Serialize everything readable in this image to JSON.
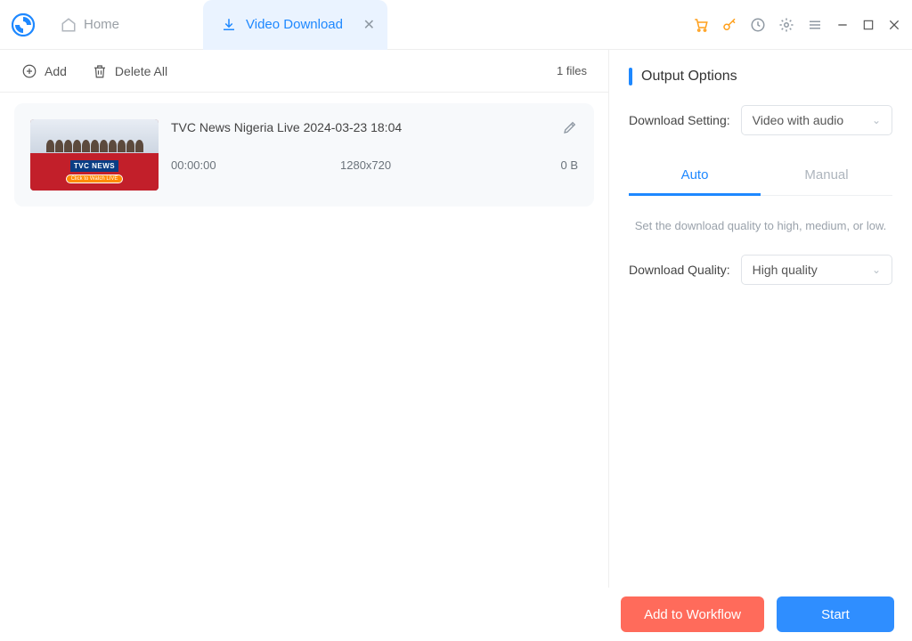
{
  "tabs": {
    "home": "Home",
    "download": "Video Download"
  },
  "toolbar": {
    "add": "Add",
    "delete_all": "Delete All",
    "file_count": "1 files"
  },
  "file": {
    "title": "TVC News Nigeria Live 2024-03-23 18:04",
    "duration": "00:00:00",
    "resolution": "1280x720",
    "size": "0 B",
    "thumb_logo": "TVC NEWS",
    "thumb_click": "Click to Watch LIVE"
  },
  "output": {
    "panel_title": "Output Options",
    "setting_label": "Download Setting:",
    "setting_value": "Video with audio",
    "tabs": {
      "auto": "Auto",
      "manual": "Manual"
    },
    "quality_hint": "Set the download quality to high, medium, or low.",
    "quality_label": "Download Quality:",
    "quality_value": "High quality"
  },
  "buttons": {
    "workflow": "Add to Workflow",
    "start": "Start"
  }
}
